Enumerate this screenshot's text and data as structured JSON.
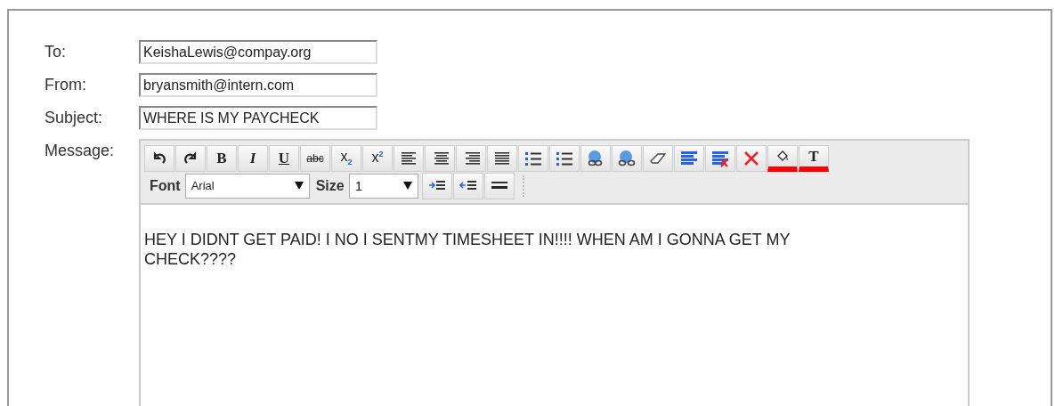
{
  "fields": [
    {
      "label": "To:",
      "value": "KeishaLewis@compay.org"
    },
    {
      "label": "From:",
      "value": "bryansmith@intern.com"
    },
    {
      "label": "Subject:",
      "value": "WHERE IS MY PAYCHECK"
    }
  ],
  "message": {
    "label": "Message:",
    "tools": [
      {
        "kind": "undo"
      },
      {
        "kind": "redo"
      },
      {
        "kind": "bold",
        "label": "B"
      },
      {
        "kind": "italic",
        "label": "I"
      },
      {
        "kind": "underline",
        "label": "U"
      },
      {
        "kind": "strike",
        "label": "abc"
      },
      {
        "kind": "sub",
        "label": "x$_{2}$"
      },
      {
        "kind": "sup",
        "label": "x$^{2}$"
      },
      {
        "kind": "align-left"
      },
      {
        "kind": "align-center"
      },
      {
        "kind": "align-right"
      },
      {
        "kind": "justify"
      },
      {
        "kind": "ordered-list"
      },
      {
        "kind": "bullet-list"
      },
      {
        "kind": "link"
      },
      {
        "kind": "unlink"
      },
      {
        "kind": "eraser"
      },
      {
        "kind": "block"
      },
      {
        "kind": "block-remove"
      },
      {
        "kind": "delete"
      },
      {
        "kind": "fill-color"
      },
      {
        "kind": "text-color",
        "label": "T"
      }
    ],
    "font_label": "Font",
    "font": "Arial",
    "size_label": "Size",
    "size": "1",
    "tools2": [
      {
        "kind": "indent"
      },
      {
        "kind": "outdent"
      },
      {
        "kind": "rule"
      }
    ],
    "body": "HEY I DIDNT GET PAID! I NO I SENTMY TIMESHEET IN!!!! WHEN AM I GONNA GET MY CHECK????"
  }
}
